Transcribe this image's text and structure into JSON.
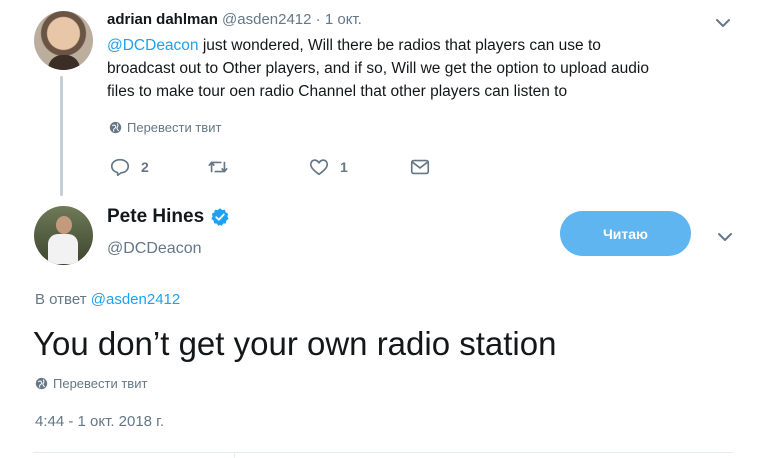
{
  "reply_tweet": {
    "author_name": "adrian dahlman",
    "handle": "@asden2412",
    "separator": "·",
    "date": "1 окт.",
    "mention": "@DCDeacon",
    "text": " just wondered, Will there be radios that players can use to broadcast out to Other players, and if so, Will we get the option to upload audio files to make tour oen radio Channel that other players can listen to",
    "translate_label": "Перевести твит",
    "reply_count": "2",
    "retweet_count": "",
    "like_count": "1",
    "icons": [
      "reply-icon",
      "retweet-icon",
      "like-icon",
      "message-icon",
      "chevron-down-icon",
      "globe-icon"
    ]
  },
  "main_tweet": {
    "author_name": "Pete Hines",
    "handle": "@DCDeacon",
    "follow_label": "Читаю",
    "reply_to_prefix": "В ответ ",
    "reply_to_handle": "@asden2412",
    "text": "You don’t get your own radio station",
    "translate_label": "Перевести твит",
    "timestamp": "4:44 - 1 окт. 2018 г.",
    "icons": [
      "verified-icon",
      "chevron-down-icon",
      "globe-icon"
    ]
  },
  "colors": {
    "accent": "#1da1f2",
    "follow_button": "#5eb5f0",
    "muted_text": "#657786",
    "thread_line": "#c4cfd6"
  }
}
